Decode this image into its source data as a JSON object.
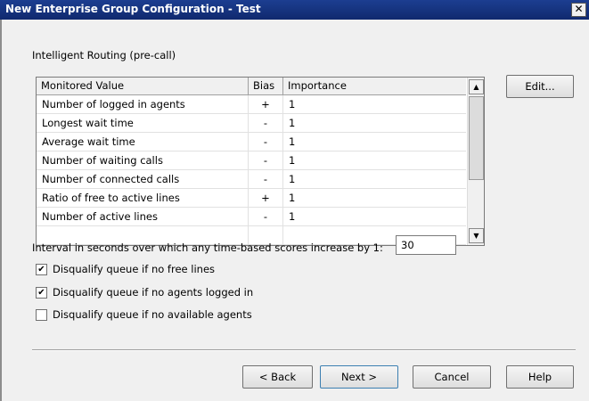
{
  "window": {
    "title": "New Enterprise Group Configuration - Test",
    "close_glyph": "✕"
  },
  "routing": {
    "section_label": "Intelligent Routing (pre-call)",
    "columns": [
      "Monitored Value",
      "Bias",
      "Importance"
    ],
    "rows": [
      {
        "value": "Number of logged in agents",
        "bias": "+",
        "importance": "1"
      },
      {
        "value": "Longest wait time",
        "bias": "-",
        "importance": "1"
      },
      {
        "value": "Average wait time",
        "bias": "-",
        "importance": "1"
      },
      {
        "value": "Number of waiting calls",
        "bias": "-",
        "importance": "1"
      },
      {
        "value": "Number of connected calls",
        "bias": "-",
        "importance": "1"
      },
      {
        "value": "Ratio of free to active lines",
        "bias": "+",
        "importance": "1"
      },
      {
        "value": "Number of active lines",
        "bias": "-",
        "importance": "1"
      },
      {
        "value": "",
        "bias": "",
        "importance": ""
      }
    ],
    "edit_label": "Edit...",
    "scroll_up_glyph": "▲",
    "scroll_down_glyph": "▼"
  },
  "interval": {
    "label": "Interval in seconds over which any time-based scores increase by 1:",
    "value": "30"
  },
  "options": [
    {
      "label": "Disqualify queue if no free lines",
      "checked": true
    },
    {
      "label": "Disqualify queue if no agents logged in",
      "checked": true
    },
    {
      "label": "Disqualify queue if no available agents",
      "checked": false
    }
  ],
  "footer": {
    "back_label": "< Back",
    "next_label": "Next >",
    "cancel_label": "Cancel",
    "help_label": "Help"
  }
}
